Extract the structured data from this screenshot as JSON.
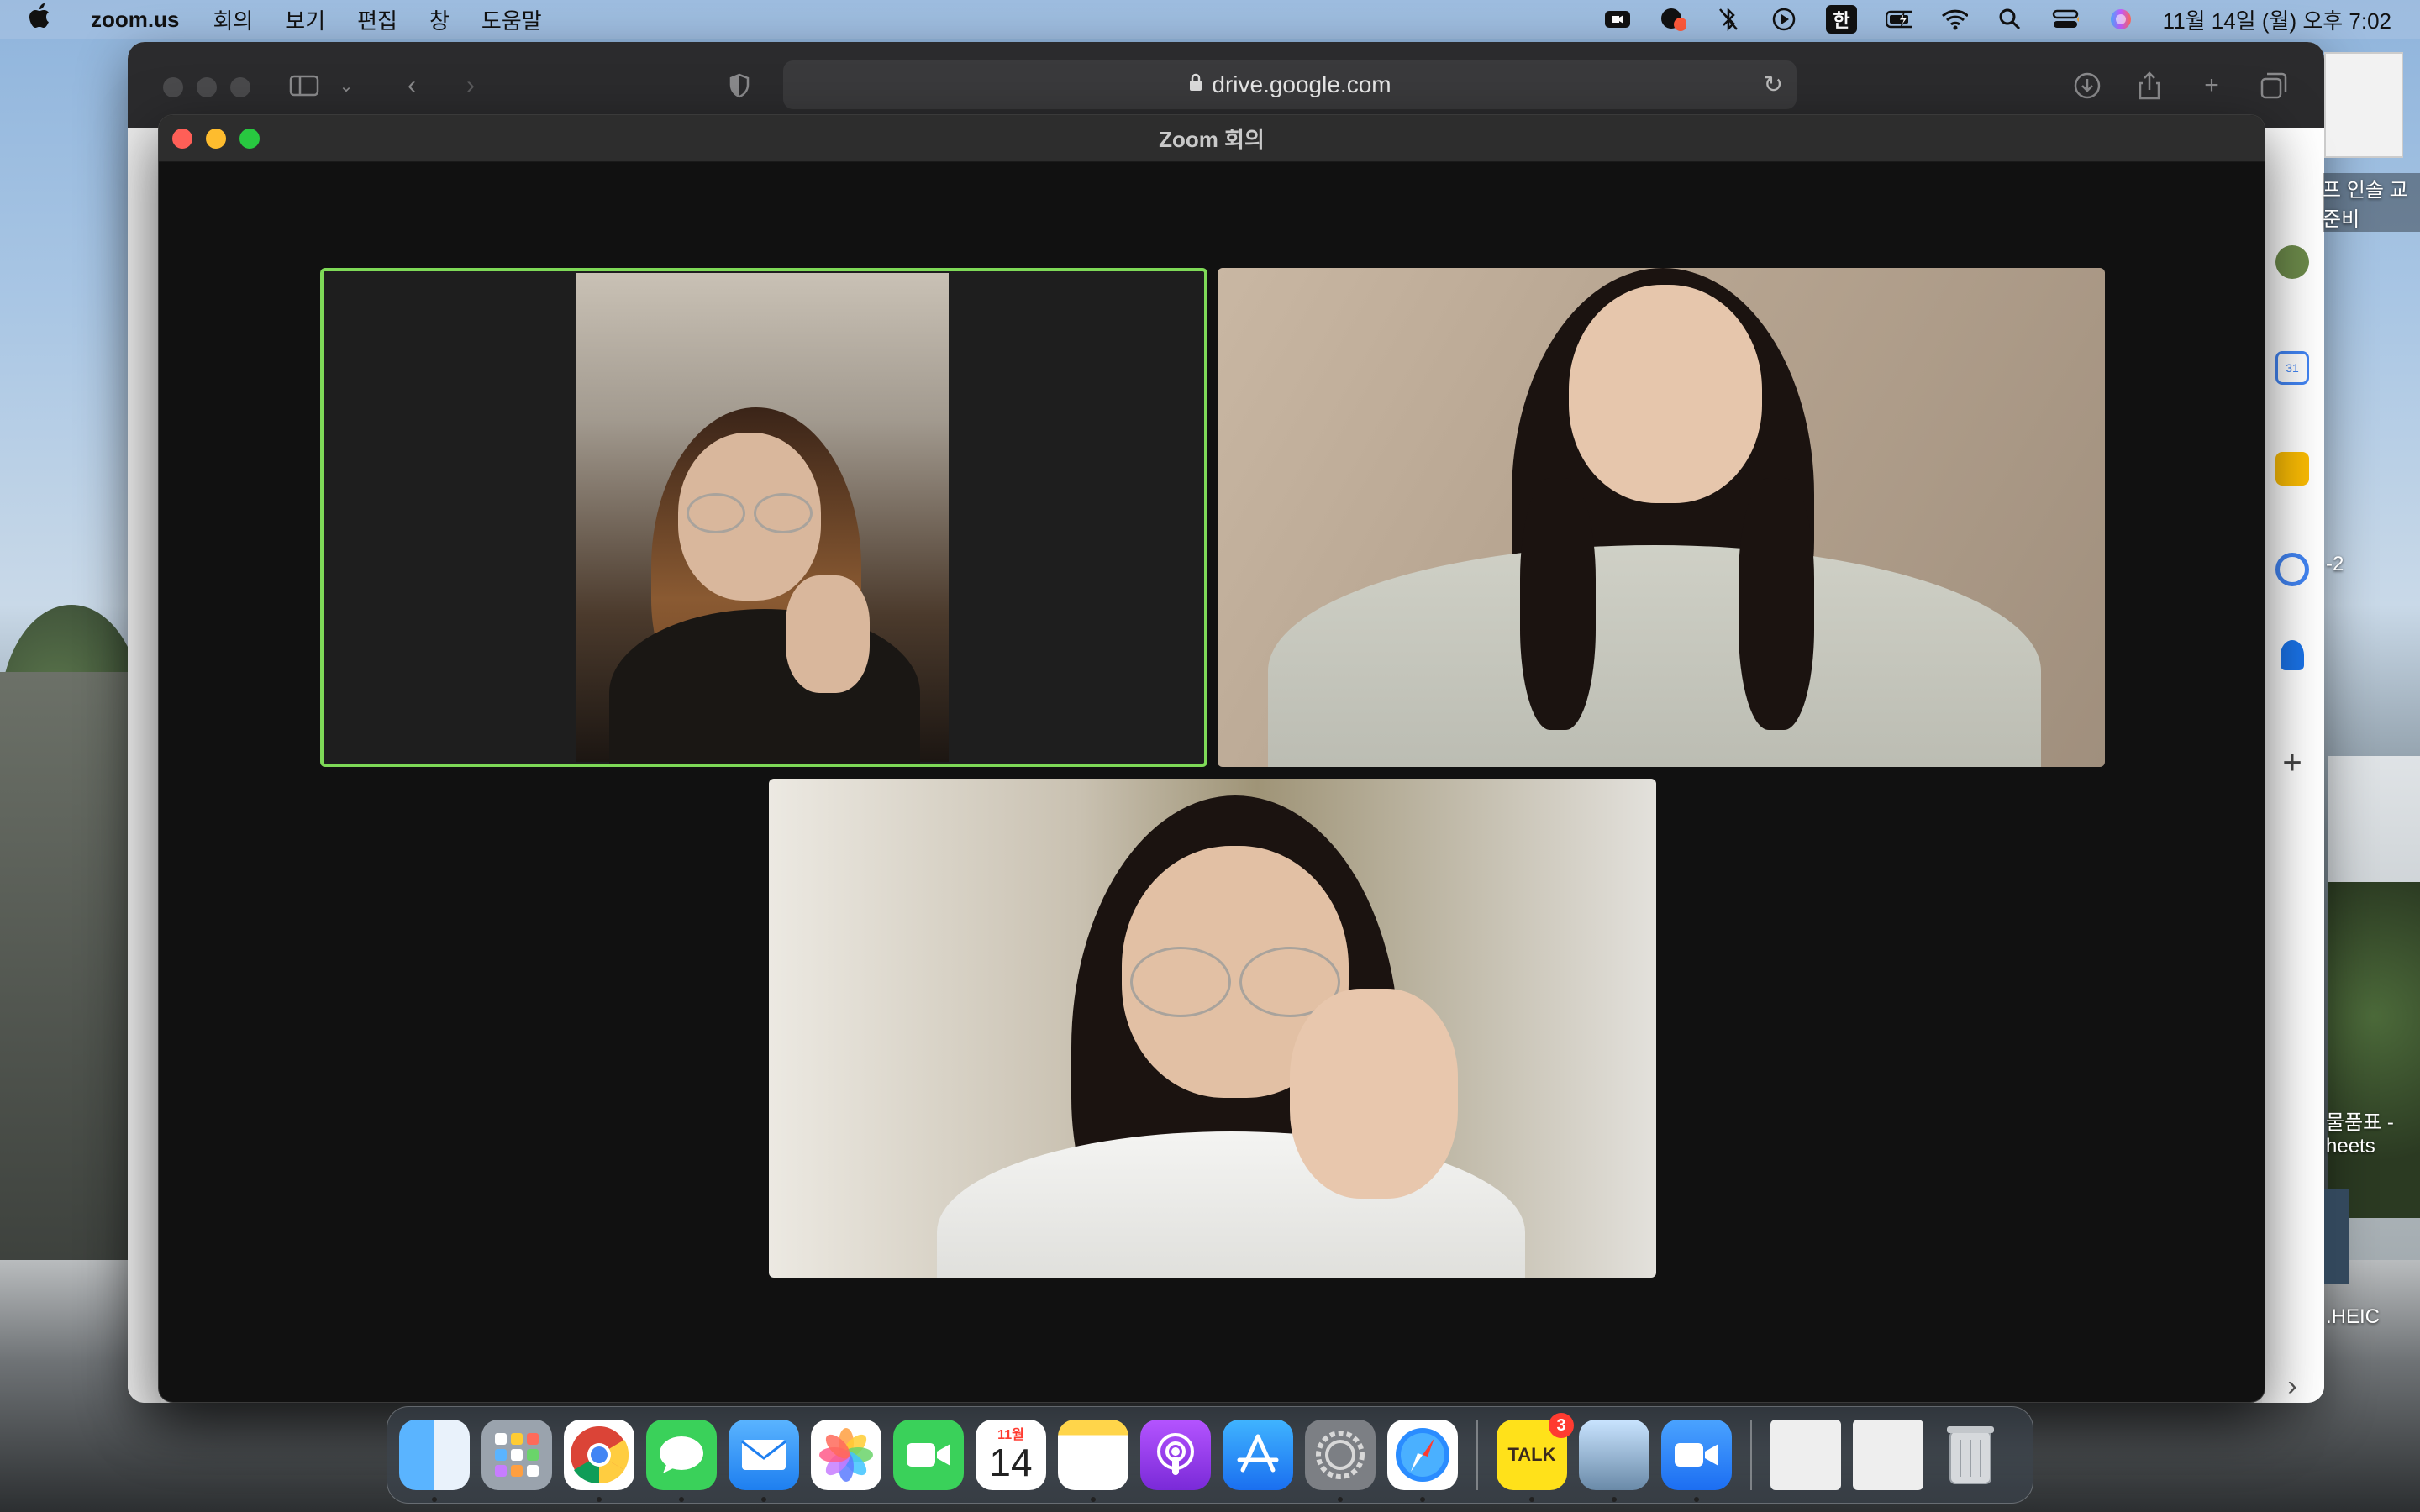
{
  "menubar": {
    "app_name": "zoom.us",
    "items": [
      "회의",
      "보기",
      "편집",
      "창",
      "도움말"
    ],
    "input_mode": "한",
    "clock": "11월 14일 (월) 오후 7:02"
  },
  "safari": {
    "url": "drive.google.com"
  },
  "zoom_window": {
    "title": "Zoom 회의"
  },
  "desktop_labels": {
    "top_file": "프 인솔 교",
    "top_file_line2": "준비",
    "number_label": "-2",
    "sheet_label": "물품표 -",
    "sheet_label_line2": "heets",
    "heic_label": ".HEIC"
  },
  "dock": {
    "calendar_month": "11월",
    "calendar_day": "14",
    "kakao_label": "TALK",
    "kakao_badge": "3"
  },
  "colors": {
    "active_speaker_border": "#7ed957",
    "zoom_bg": "#111111"
  }
}
